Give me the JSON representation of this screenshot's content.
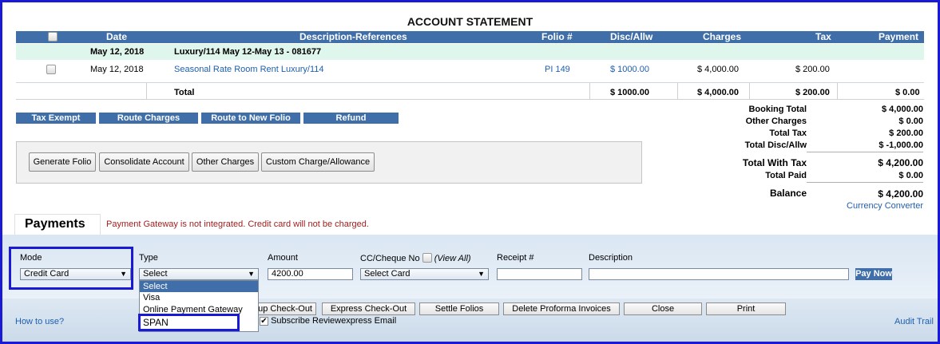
{
  "statement": {
    "title": "ACCOUNT STATEMENT",
    "headers": {
      "date": "Date",
      "description": "Description-References",
      "folio": "Folio #",
      "disc": "Disc/Allw",
      "charges": "Charges",
      "tax": "Tax",
      "payment": "Payment"
    },
    "group": {
      "date": "May 12, 2018",
      "description": "Luxury/114 May 12-May 13 - 081677"
    },
    "row": {
      "date": "May 12, 2018",
      "description": "Seasonal Rate Room Rent Luxury/114",
      "folio": "PI 149",
      "disc": "$ 1000.00",
      "charges": "$ 4,000.00",
      "tax": "$ 200.00"
    },
    "total": {
      "label": "Total",
      "disc": "$ 1000.00",
      "charges": "$ 4,000.00",
      "tax": "$ 200.00",
      "payment": "$ 0.00"
    }
  },
  "actions": {
    "tax_exempt": "Tax Exempt",
    "route_charges": "Route Charges",
    "route_new_folio": "Route to New Folio",
    "refund": "Refund"
  },
  "summary": {
    "booking_total_label": "Booking Total",
    "booking_total": "$ 4,000.00",
    "other_charges_label": "Other Charges",
    "other_charges": "$ 0.00",
    "total_tax_label": "Total Tax",
    "total_tax": "$ 200.00",
    "total_disc_label": "Total Disc/Allw",
    "total_disc": "$ -1,000.00",
    "total_with_tax_label": "Total With Tax",
    "total_with_tax": "$ 4,200.00",
    "total_paid_label": "Total Paid",
    "total_paid": "$ 0.00",
    "balance_label": "Balance",
    "balance": "$ 4,200.00",
    "currency_converter": "Currency Converter"
  },
  "buttons": {
    "generate_folio": "Generate Folio",
    "consolidate": "Consolidate Account",
    "other_charges": "Other Charges",
    "custom_charge": "Custom Charge/Allowance"
  },
  "payments": {
    "tab": "Payments",
    "warning": "Payment Gateway is not integrated. Credit card will not be charged.",
    "mode_label": "Mode",
    "mode_value": "Credit Card",
    "type_label": "Type",
    "type_value": "Select",
    "amount_label": "Amount",
    "amount_value": "4200.00",
    "cc_label": "CC/Cheque No",
    "view_all": "(View All)",
    "cc_value": "Select Card",
    "receipt_label": "Receipt #",
    "description_label": "Description",
    "pay_now": "Pay Now",
    "type_options": [
      "Select",
      "Visa",
      "Online Payment Gateway",
      "SPAN"
    ]
  },
  "footer": {
    "group_checkout": "up Check-Out",
    "express_checkout": "Express Check-Out",
    "settle_folios": "Settle Folios",
    "delete_proforma": "Delete Proforma Invoices",
    "close": "Close",
    "print": "Print",
    "subscribe": "Subscribe Reviewexpress Email",
    "how_to_use": "How to use?",
    "audit_trail": "Audit Trail"
  }
}
